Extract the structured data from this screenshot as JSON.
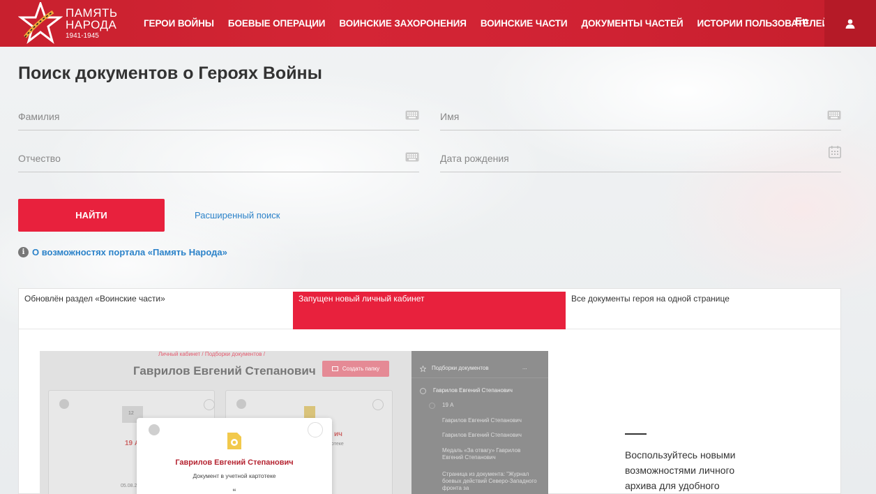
{
  "header": {
    "logo": {
      "line1": "ПАМЯТЬ",
      "line2": "НАРОДА",
      "years": "1941-1945"
    },
    "nav": [
      "ГЕРОИ ВОЙНЫ",
      "БОЕВЫЕ ОПЕРАЦИИ",
      "ВОИНСКИЕ ЗАХОРОНЕНИЯ",
      "ВОИНСКИЕ ЧАСТИ",
      "ДОКУМЕНТЫ ЧАСТЕЙ",
      "ИСТОРИИ ПОЛЬЗОВАТЕЛЕЙ"
    ],
    "lang": "En",
    "user_icon": "user-icon"
  },
  "search": {
    "title": "Поиск документов о Героях Войны",
    "fields": {
      "surname": "Фамилия",
      "name": "Имя",
      "patronymic": "Отчество",
      "birthdate": "Дата рождения"
    },
    "find_label": "НАЙТИ",
    "advanced_label": "Расширенный поиск",
    "about_label": "О возможностях портала «Память Народа»"
  },
  "news": {
    "tabs": [
      "Обновлён раздел «Воинские части»",
      "Запущен новый личный кабинет",
      "Все документы героя на одной странице"
    ],
    "active_tab": 1,
    "preview": {
      "crumb": "Личный кабинет / Подборки документов /",
      "name": "Гаврилов Евгений Степанович",
      "create_folder": "Создать папку",
      "card_num": "12",
      "card_label": "19 А",
      "card_date": "05.08.2",
      "card2_name": "ич",
      "card2_sub": "отеке",
      "popup_name": "Гаврилов Евгений Степанович",
      "popup_desc": "Документ в учетной картотеке",
      "popup_quote": "“",
      "sidebar_title": "Подборки документов",
      "sidebar_more": "...",
      "sidebar_items": [
        "Гаврилов Евгений Степанович",
        "19 А",
        "Гаврилов Евгений Степанович",
        "Гаврилов Евгений Степанович",
        "Медаль «За отвагу» Гаврилов Евгений Степанович",
        "Страница из документа: \"Журнал боевых действий Северо-Западного фронта за"
      ]
    },
    "promo_text": "Воспользуйтесь новыми возможностями личного архива для удобного"
  },
  "colors": {
    "brand_red": "#d42535",
    "accent": "#e8213d",
    "link": "#2b82c9"
  }
}
